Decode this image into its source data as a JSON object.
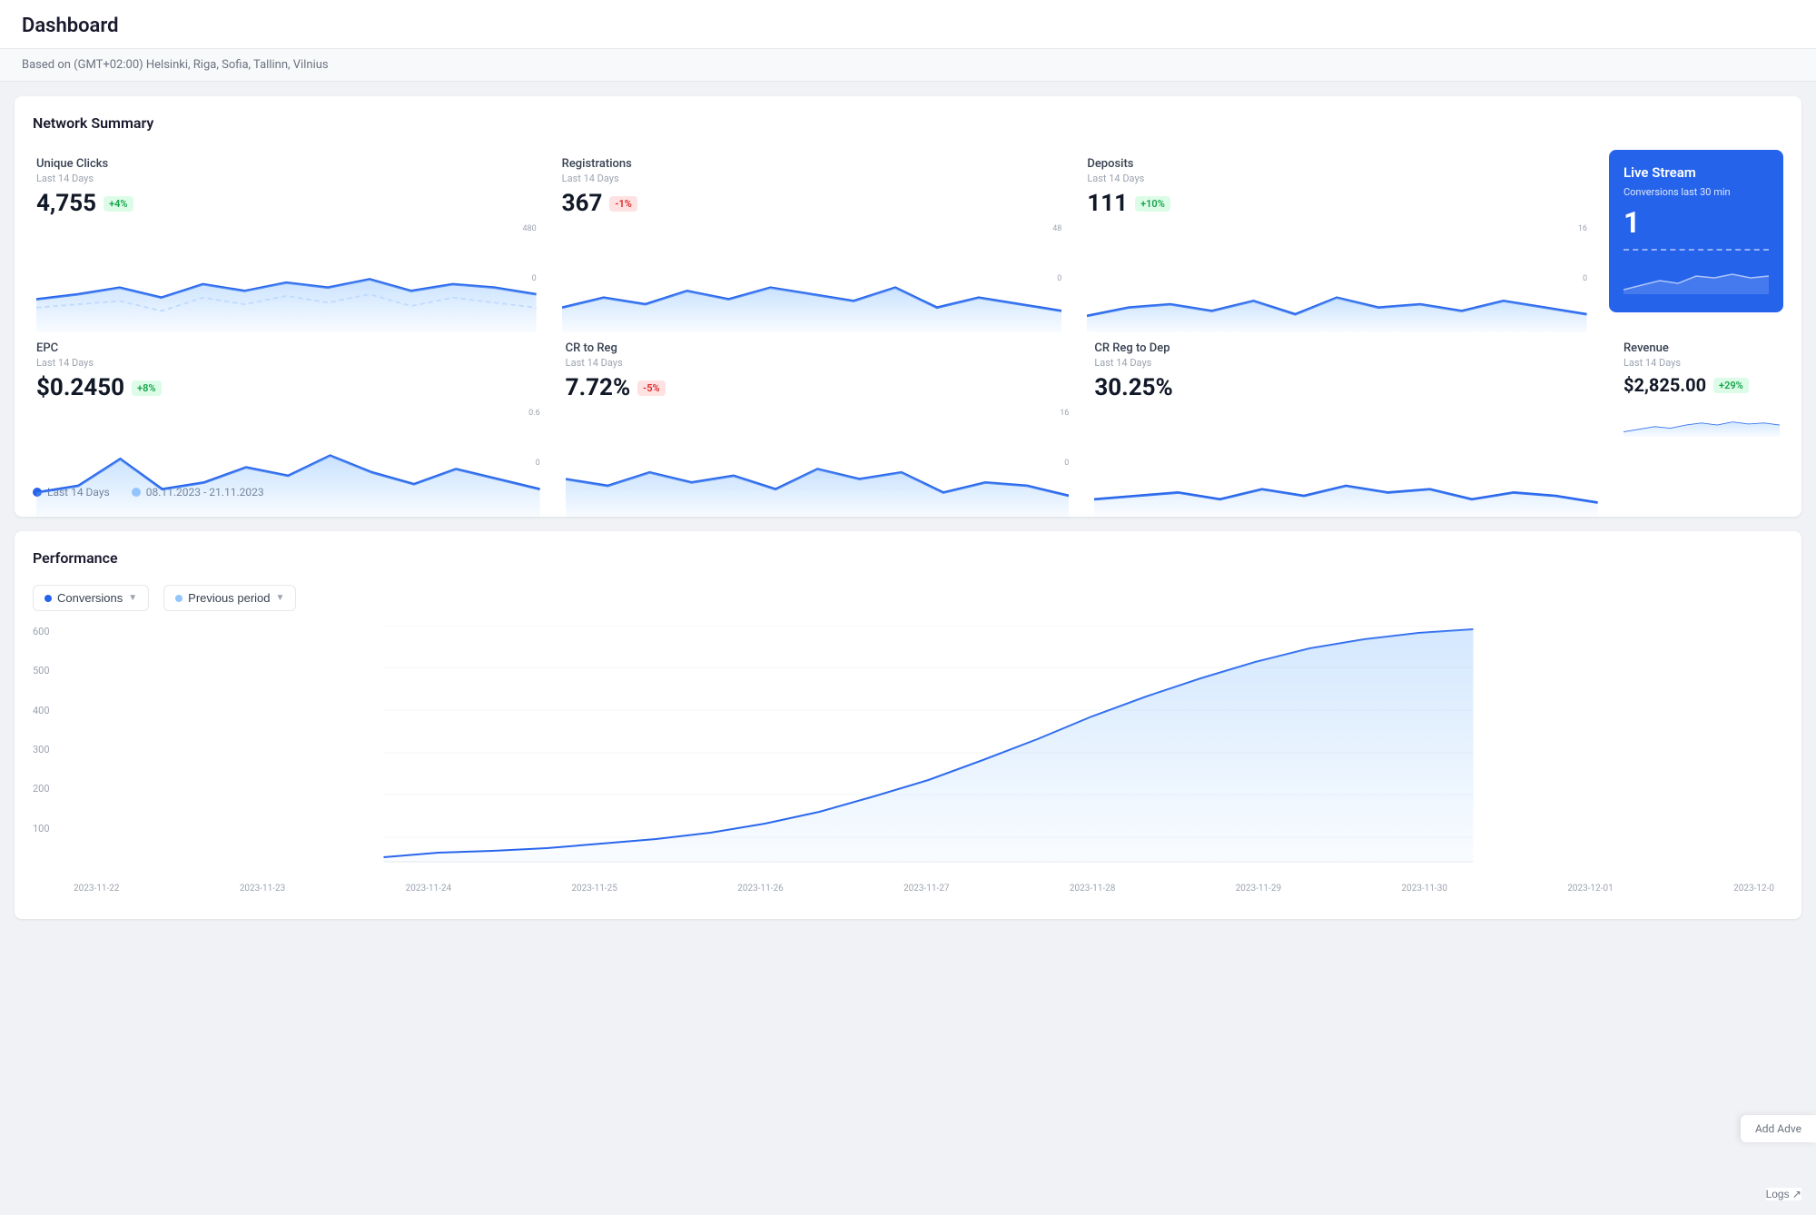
{
  "header": {
    "title": "Dashboard"
  },
  "timezone": {
    "text": "Based on (GMT+02:00) Helsinki, Riga, Sofia, Tallinn, Vilnius"
  },
  "network_summary": {
    "title": "Network Summary",
    "metrics_row1": [
      {
        "label": "Unique Clicks",
        "period": "Last 14 Days",
        "value": "4,755",
        "badge": "+4%",
        "badge_type": "positive",
        "chart_max": "480",
        "chart_min": "0"
      },
      {
        "label": "Registrations",
        "period": "Last 14 Days",
        "value": "367",
        "badge": "-1%",
        "badge_type": "negative",
        "chart_max": "48",
        "chart_min": "0"
      },
      {
        "label": "Deposits",
        "period": "Last 14 Days",
        "value": "111",
        "badge": "+10%",
        "badge_type": "positive",
        "chart_max": "16",
        "chart_min": "0"
      }
    ],
    "live_stream": {
      "title": "Live Stream",
      "subtitle": "Conversions last 30 min",
      "value": "1"
    },
    "metrics_row2": [
      {
        "label": "EPC",
        "period": "Last 14 Days",
        "value": "$0.2450",
        "badge": "+8%",
        "badge_type": "positive",
        "chart_max": "0.6",
        "chart_min": "0"
      },
      {
        "label": "CR to Reg",
        "period": "Last 14 Days",
        "value": "7.72%",
        "badge": "-5%",
        "badge_type": "negative",
        "chart_max": "16",
        "chart_min": "0"
      },
      {
        "label": "CR Reg to Dep",
        "period": "Last 14 Days",
        "value": "30.25%",
        "badge": null,
        "badge_type": null,
        "chart_max": "",
        "chart_min": ""
      }
    ],
    "revenue": {
      "label": "Revenue",
      "period": "Last 14 Days",
      "value": "$2,825.00",
      "badge": "+29%",
      "badge_type": "positive"
    },
    "legend": [
      {
        "label": "Last 14 Days",
        "color": "#2563eb"
      },
      {
        "label": "08.11.2023 - 21.11.2023",
        "color": "#93c5fd"
      }
    ]
  },
  "performance": {
    "title": "Performance",
    "dropdown1": {
      "label": "Conversions",
      "dot_color": "#2563eb"
    },
    "dropdown2": {
      "label": "Previous period",
      "dot_color": "#93c5fd"
    },
    "y_axis": [
      "600",
      "500",
      "400",
      "300",
      "200",
      "100",
      ""
    ],
    "x_axis": [
      "2023-11-22",
      "2023-11-23",
      "2023-11-24",
      "2023-11-25",
      "2023-11-26",
      "2023-11-27",
      "2023-11-28",
      "2023-11-29",
      "2023-11-30",
      "2023-12-01",
      "2023-12-0"
    ]
  },
  "footer": {
    "logs_label": "Logs ↗",
    "add_adve_label": "Add Adve"
  }
}
